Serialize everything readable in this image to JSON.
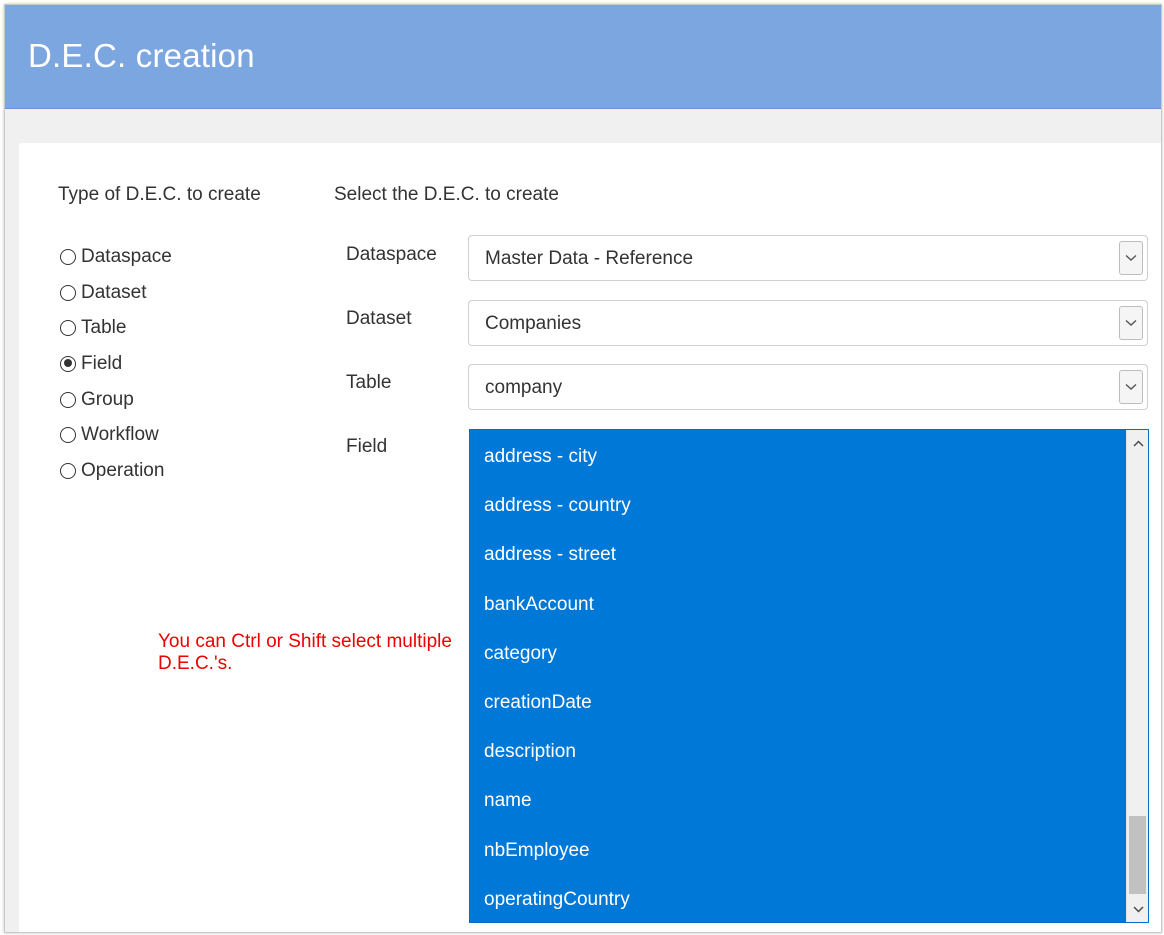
{
  "window": {
    "title": "D.E.C. creation",
    "accent_color": "#7ba6df"
  },
  "type_section": {
    "heading": "Type of D.E.C. to create",
    "options": [
      {
        "label": "Dataspace",
        "checked": false
      },
      {
        "label": "Dataset",
        "checked": false
      },
      {
        "label": "Table",
        "checked": false
      },
      {
        "label": "Field",
        "checked": true
      },
      {
        "label": "Group",
        "checked": false
      },
      {
        "label": "Workflow",
        "checked": false
      },
      {
        "label": "Operation",
        "checked": false
      }
    ]
  },
  "select_section": {
    "heading": "Select the D.E.C. to create",
    "dataspace": {
      "label": "Dataspace",
      "value": "Master Data - Reference"
    },
    "dataset": {
      "label": "Dataset",
      "value": "Companies"
    },
    "table": {
      "label": "Table",
      "value": "company"
    },
    "field": {
      "label": "Field",
      "selection_color": "#0078d7",
      "items": [
        "address - city",
        "address - country",
        "address - street",
        "bankAccount",
        "category",
        "creationDate",
        "description",
        "name",
        "nbEmployee",
        "operatingCountry"
      ]
    }
  },
  "hint": {
    "text": "You can Ctrl or Shift select multiple D.E.C.'s.",
    "color": "#ee0000"
  }
}
